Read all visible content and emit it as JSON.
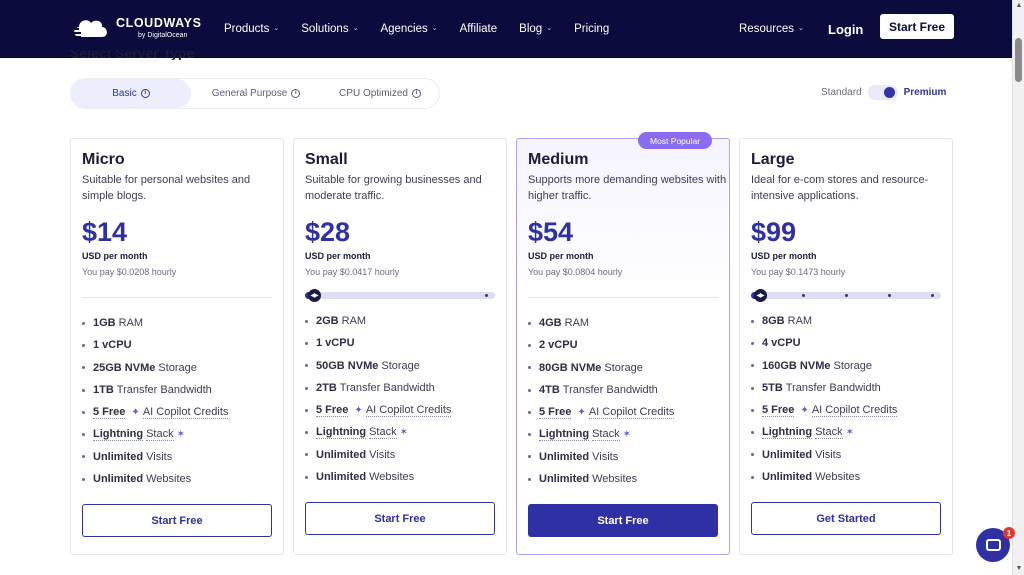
{
  "brand": {
    "name": "CLOUDWAYS",
    "sub": "by DigitalOcean"
  },
  "nav": {
    "links": [
      {
        "label": "Products",
        "dropdown": true
      },
      {
        "label": "Solutions",
        "dropdown": true
      },
      {
        "label": "Agencies",
        "dropdown": true
      },
      {
        "label": "Affiliate",
        "dropdown": false
      },
      {
        "label": "Blog",
        "dropdown": true
      },
      {
        "label": "Pricing",
        "dropdown": false
      }
    ],
    "resources": "Resources",
    "login": "Login",
    "start_free": "Start Free"
  },
  "section": {
    "heading": "Select Server Type"
  },
  "tabs": [
    {
      "label": "Basic",
      "active": true
    },
    {
      "label": "General Purpose",
      "active": false
    },
    {
      "label": "CPU Optimized",
      "active": false
    }
  ],
  "toggle": {
    "left_label": "Standard",
    "right_label": "Premium",
    "selected": "Premium"
  },
  "plans": [
    {
      "name": "Micro",
      "desc": "Suitable for personal websites and simple blogs.",
      "price": "$14",
      "period": "USD per month",
      "hourly": "You pay $0.0208 hourly",
      "features": {
        "ram": "1GB",
        "ram_label": "RAM",
        "cpu": "1 vCPU",
        "storage": "25GB NVMe",
        "storage_label": "Storage",
        "bandwidth": "1TB",
        "bandwidth_label": "Transfer Bandwidth",
        "ai": "5 Free",
        "ai_label": "AI Copilot Credits",
        "stack": "Lightning",
        "stack_label": "Stack",
        "visits": "Unlimited",
        "visits_label": "Visits",
        "websites": "Unlimited",
        "websites_label": "Websites"
      },
      "button": "Start Free"
    },
    {
      "name": "Small",
      "desc": "Suitable for growing businesses and moderate traffic.",
      "price": "$28",
      "period": "USD per month",
      "hourly": "You pay $0.0417 hourly",
      "features": {
        "ram": "2GB",
        "ram_label": "RAM",
        "cpu": "1 vCPU",
        "storage": "50GB NVMe",
        "storage_label": "Storage",
        "bandwidth": "2TB",
        "bandwidth_label": "Transfer Bandwidth",
        "ai": "5 Free",
        "ai_label": "AI Copilot Credits",
        "stack": "Lightning",
        "stack_label": "Stack",
        "visits": "Unlimited",
        "visits_label": "Visits",
        "websites": "Unlimited",
        "websites_label": "Websites"
      },
      "button": "Start Free"
    },
    {
      "name": "Medium",
      "badge": "Most Popular",
      "desc": "Supports more demanding websites with higher traffic.",
      "price": "$54",
      "period": "USD per month",
      "hourly": "You pay $0.0804 hourly",
      "features": {
        "ram": "4GB",
        "ram_label": "RAM",
        "cpu": "2 vCPU",
        "storage": "80GB NVMe",
        "storage_label": "Storage",
        "bandwidth": "4TB",
        "bandwidth_label": "Transfer Bandwidth",
        "ai": "5 Free",
        "ai_label": "AI Copilot Credits",
        "stack": "Lightning",
        "stack_label": "Stack",
        "visits": "Unlimited",
        "visits_label": "Visits",
        "websites": "Unlimited",
        "websites_label": "Websites"
      },
      "button": "Start Free"
    },
    {
      "name": "Large",
      "desc": "Ideal for e-com stores and resource-intensive applications.",
      "price": "$99",
      "period": "USD per month",
      "hourly": "You pay $0.1473 hourly",
      "features": {
        "ram": "8GB",
        "ram_label": "RAM",
        "cpu": "4 vCPU",
        "storage": "160GB NVMe",
        "storage_label": "Storage",
        "bandwidth": "5TB",
        "bandwidth_label": "Transfer Bandwidth",
        "ai": "5 Free",
        "ai_label": "AI Copilot Credits",
        "stack": "Lightning",
        "stack_label": "Stack",
        "visits": "Unlimited",
        "visits_label": "Visits",
        "websites": "Unlimited",
        "websites_label": "Websites"
      },
      "button": "Get Started"
    }
  ],
  "sliders": {
    "small": {
      "steps": 2,
      "selected": 1
    },
    "large": {
      "steps": 5,
      "selected": 1
    }
  },
  "chat": {
    "badge": "1"
  },
  "colors": {
    "nav_bg": "#0b0b3d",
    "accent": "#2e30a3",
    "badge": "#8b6cf0",
    "notify": "#e2372c"
  }
}
